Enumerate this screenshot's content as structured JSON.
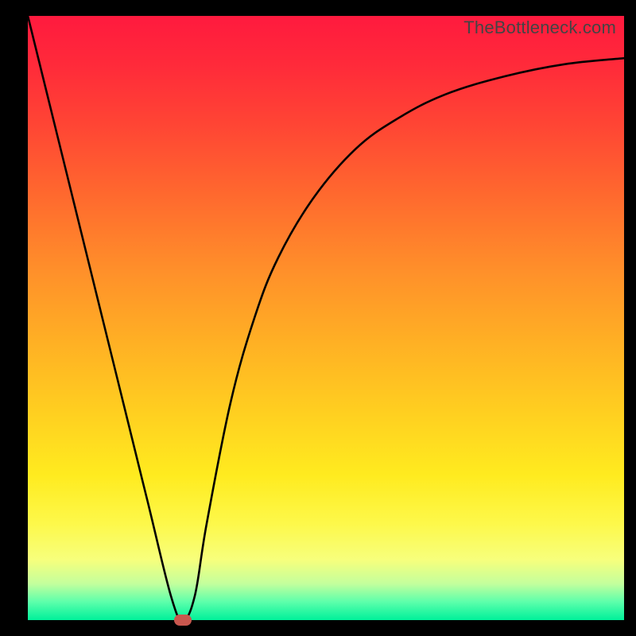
{
  "watermark": "TheBottleneck.com",
  "chart_data": {
    "type": "line",
    "title": "",
    "xlabel": "",
    "ylabel": "",
    "xlim": [
      0,
      100
    ],
    "ylim": [
      0,
      100
    ],
    "background_gradient": {
      "top": "#ff1a3e",
      "bottom": "#00f09a",
      "meaning": "top = high bottleneck (bad/red), bottom = no bottleneck (good/green)"
    },
    "series": [
      {
        "name": "bottleneck-curve",
        "x": [
          0,
          5,
          10,
          15,
          20,
          24,
          26,
          28,
          30,
          34,
          38,
          42,
          48,
          55,
          62,
          70,
          80,
          90,
          100
        ],
        "values": [
          100,
          80,
          60,
          40,
          20,
          4,
          0,
          4,
          16,
          36,
          50,
          60,
          70,
          78,
          83,
          87,
          90,
          92,
          93
        ]
      }
    ],
    "annotations": [
      {
        "name": "optimal-point-marker",
        "x": 26,
        "y": 0,
        "color": "#c9574e",
        "shape": "rounded-rect"
      }
    ]
  }
}
